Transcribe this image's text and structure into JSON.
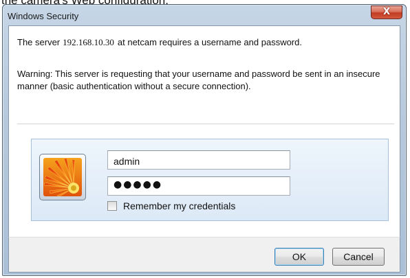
{
  "page": {
    "caption": "the camera's Web configuration."
  },
  "window": {
    "title": "Windows Security",
    "close_glyph": "X"
  },
  "message": {
    "prefix": "The server",
    "server": "192.168.10.30",
    "suffix": "at netcam requires a username and password."
  },
  "warning": "Warning: This server is requesting that your username and password be sent in an insecure manner (basic authentication without a secure connection).",
  "credentials": {
    "username": "admin",
    "password_mask": "●●●●●",
    "remember_label": "Remember my credentials",
    "remember_checked": false
  },
  "buttons": {
    "ok": "OK",
    "cancel": "Cancel"
  },
  "icons": {
    "avatar": "flower-avatar-icon",
    "close": "close-icon"
  },
  "colors": {
    "close_button": "#c23b22",
    "title_bar": "#b7c9dc",
    "ok_focus": "#3c7fb1"
  }
}
